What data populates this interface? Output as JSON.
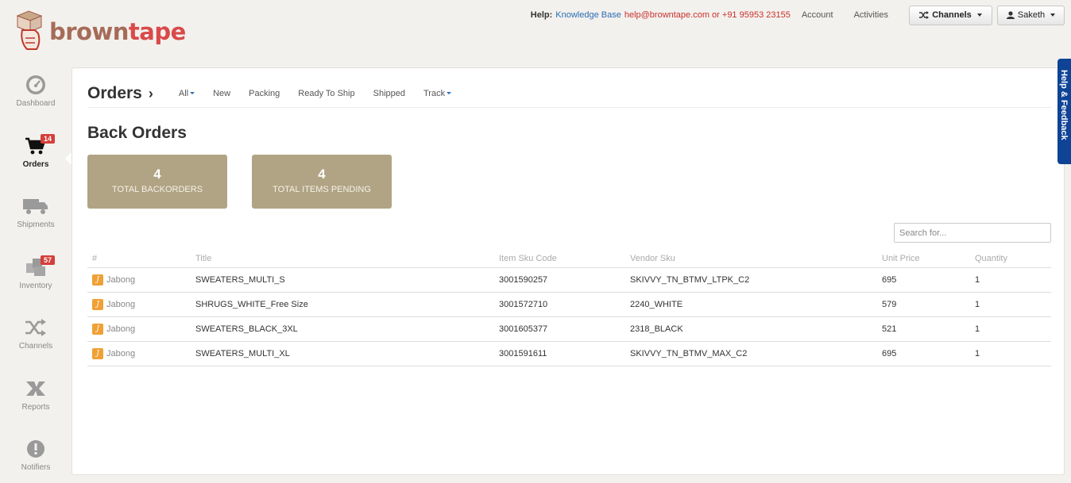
{
  "brand": {
    "part1": "brown",
    "part2": "tape"
  },
  "topbar": {
    "help_label": "Help:",
    "knowledge_base": "Knowledge Base",
    "contact": "help@browntape.com or +91 95953 23155",
    "account": "Account",
    "activities": "Activities",
    "channels_button": "Channels",
    "user_button": "Saketh"
  },
  "sidebar": {
    "items": [
      {
        "label": "Dashboard",
        "icon": "dashboard-gauge-icon"
      },
      {
        "label": "Orders",
        "icon": "cart-icon",
        "badge": "14",
        "active": true
      },
      {
        "label": "Shipments",
        "icon": "truck-icon"
      },
      {
        "label": "Inventory",
        "icon": "boxes-icon",
        "badge": "57"
      },
      {
        "label": "Channels",
        "icon": "shuffle-icon"
      },
      {
        "label": "Reports",
        "icon": "reports-icon"
      },
      {
        "label": "Notifiers",
        "icon": "alert-icon"
      }
    ]
  },
  "subnav": {
    "title": "Orders",
    "tabs": [
      {
        "label": "All",
        "dropdown": true
      },
      {
        "label": "New"
      },
      {
        "label": "Packing"
      },
      {
        "label": "Ready To Ship"
      },
      {
        "label": "Shipped"
      },
      {
        "label": "Track",
        "dropdown": true
      }
    ]
  },
  "page": {
    "title": "Back Orders"
  },
  "stats": [
    {
      "value": "4",
      "label": "TOTAL BACKORDERS"
    },
    {
      "value": "4",
      "label": "TOTAL ITEMS PENDING"
    }
  ],
  "search": {
    "placeholder": "Search for..."
  },
  "table": {
    "columns": [
      "#",
      "Title",
      "Item Sku Code",
      "Vendor Sku",
      "Unit Price",
      "Quantity"
    ],
    "rows": [
      {
        "channel": "Jabong",
        "title": "SWEATERS_MULTI_S",
        "sku": "3001590257",
        "vendor_sku": "SKIVVY_TN_BTMV_LTPK_C2",
        "price": "695",
        "qty": "1"
      },
      {
        "channel": "Jabong",
        "title": "SHRUGS_WHITE_Free Size",
        "sku": "3001572710",
        "vendor_sku": "2240_WHITE",
        "price": "579",
        "qty": "1"
      },
      {
        "channel": "Jabong",
        "title": "SWEATERS_BLACK_3XL",
        "sku": "3001605377",
        "vendor_sku": "2318_BLACK",
        "price": "521",
        "qty": "1"
      },
      {
        "channel": "Jabong",
        "title": "SWEATERS_MULTI_XL",
        "sku": "3001591611",
        "vendor_sku": "SKIVVY_TN_BTMV_MAX_C2",
        "price": "695",
        "qty": "1"
      }
    ]
  },
  "feedback": {
    "label": "Help & Feedback"
  },
  "colors": {
    "accent_card": "#b0a484",
    "badge": "#d43f3a",
    "feedback_tab": "#0e4395",
    "link": "#2a6db4",
    "contact": "#c9302c"
  }
}
